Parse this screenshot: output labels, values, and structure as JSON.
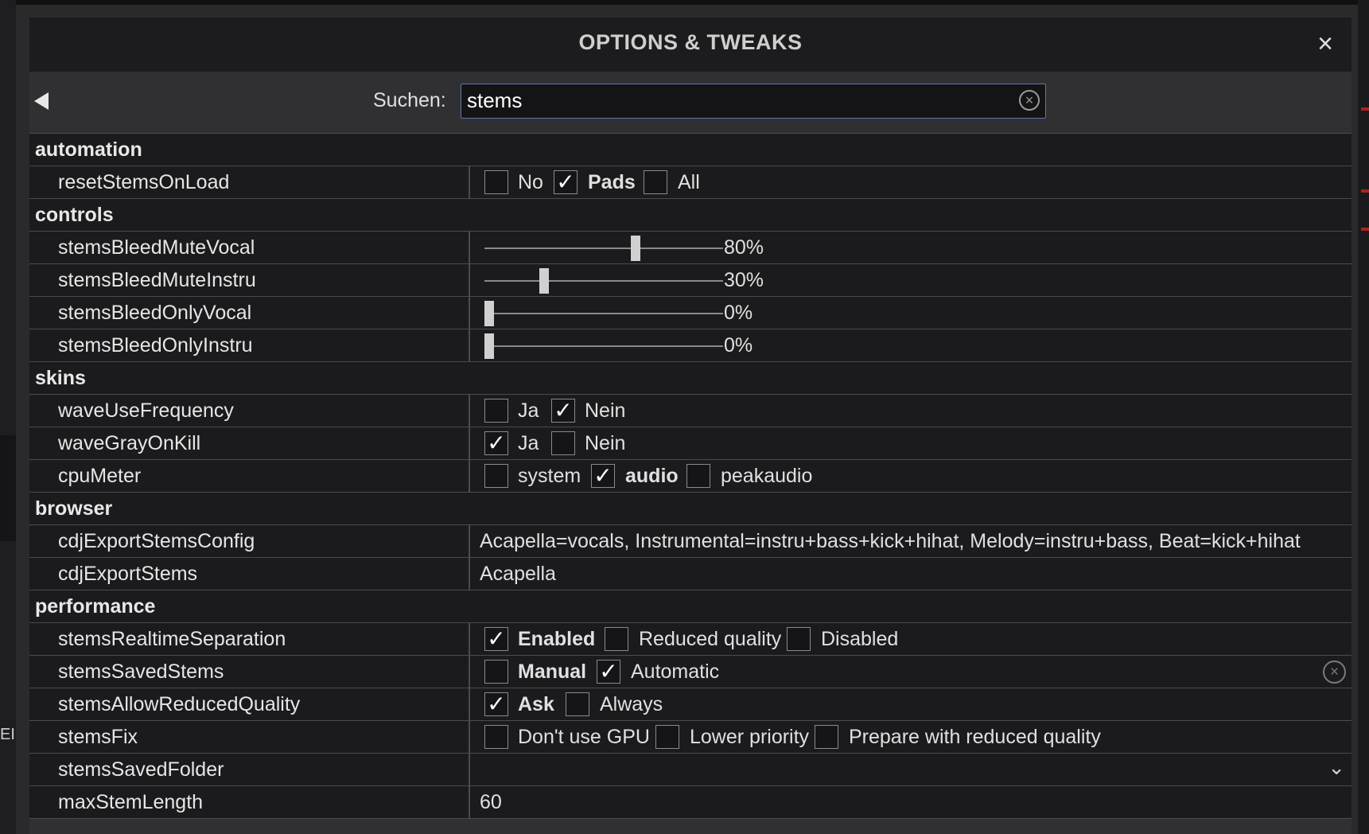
{
  "dialog": {
    "title": "OPTIONS & TWEAKS",
    "close_icon": "close-icon",
    "back_icon": "triangle-left-icon"
  },
  "search": {
    "label": "Suchen:",
    "value": "stems"
  },
  "left_edge_text": "EI",
  "rows": [
    {
      "type": "category",
      "label": "automation"
    },
    {
      "type": "radio",
      "name": "resetStemsOnLoad",
      "options": [
        {
          "label": "No",
          "checked": false,
          "bold": false
        },
        {
          "label": "Pads",
          "checked": true,
          "bold": true
        },
        {
          "label": "All",
          "checked": false,
          "bold": false
        }
      ]
    },
    {
      "type": "category",
      "label": "controls"
    },
    {
      "type": "slider",
      "name": "stemsBleedMuteVocal",
      "value": 80,
      "display": "80%"
    },
    {
      "type": "slider",
      "name": "stemsBleedMuteInstru",
      "value": 30,
      "display": "30%"
    },
    {
      "type": "slider",
      "name": "stemsBleedOnlyVocal",
      "value": 0,
      "display": "0%"
    },
    {
      "type": "slider",
      "name": "stemsBleedOnlyInstru",
      "value": 0,
      "display": "0%"
    },
    {
      "type": "category",
      "label": "skins"
    },
    {
      "type": "radio",
      "name": "waveUseFrequency",
      "options": [
        {
          "label": "Ja",
          "checked": false,
          "bold": false
        },
        {
          "label": "Nein",
          "checked": true,
          "bold": false
        }
      ]
    },
    {
      "type": "radio",
      "name": "waveGrayOnKill",
      "options": [
        {
          "label": "Ja",
          "checked": true,
          "bold": false
        },
        {
          "label": "Nein",
          "checked": false,
          "bold": false
        }
      ]
    },
    {
      "type": "radio",
      "name": "cpuMeter",
      "options": [
        {
          "label": "system",
          "checked": false,
          "bold": false
        },
        {
          "label": "audio",
          "checked": true,
          "bold": true
        },
        {
          "label": "peakaudio",
          "checked": false,
          "bold": false
        }
      ]
    },
    {
      "type": "category",
      "label": "browser"
    },
    {
      "type": "text",
      "name": "cdjExportStemsConfig",
      "value": "Acapella=vocals, Instrumental=instru+bass+kick+hihat, Melody=instru+bass, Beat=kick+hihat"
    },
    {
      "type": "text",
      "name": "cdjExportStems",
      "value": "Acapella"
    },
    {
      "type": "category",
      "label": "performance"
    },
    {
      "type": "radio",
      "name": "stemsRealtimeSeparation",
      "options": [
        {
          "label": "Enabled",
          "checked": true,
          "bold": true
        },
        {
          "label": "Reduced quality",
          "checked": false,
          "bold": false
        },
        {
          "label": "Disabled",
          "checked": false,
          "bold": false
        }
      ]
    },
    {
      "type": "radio",
      "name": "stemsSavedStems",
      "reset": true,
      "options": [
        {
          "label": "Manual",
          "checked": false,
          "bold": true
        },
        {
          "label": "Automatic",
          "checked": true,
          "bold": false
        }
      ]
    },
    {
      "type": "radio",
      "name": "stemsAllowReducedQuality",
      "options": [
        {
          "label": "Ask",
          "checked": true,
          "bold": true
        },
        {
          "label": "Always",
          "checked": false,
          "bold": false
        }
      ]
    },
    {
      "type": "radio",
      "name": "stemsFix",
      "options": [
        {
          "label": "Don't use GPU",
          "checked": false,
          "bold": false
        },
        {
          "label": "Lower priority",
          "checked": false,
          "bold": false
        },
        {
          "label": "Prepare with reduced quality",
          "checked": false,
          "bold": false
        }
      ]
    },
    {
      "type": "dropdown",
      "name": "stemsSavedFolder",
      "value": ""
    },
    {
      "type": "text",
      "name": "maxStemLength",
      "value": "60"
    }
  ]
}
